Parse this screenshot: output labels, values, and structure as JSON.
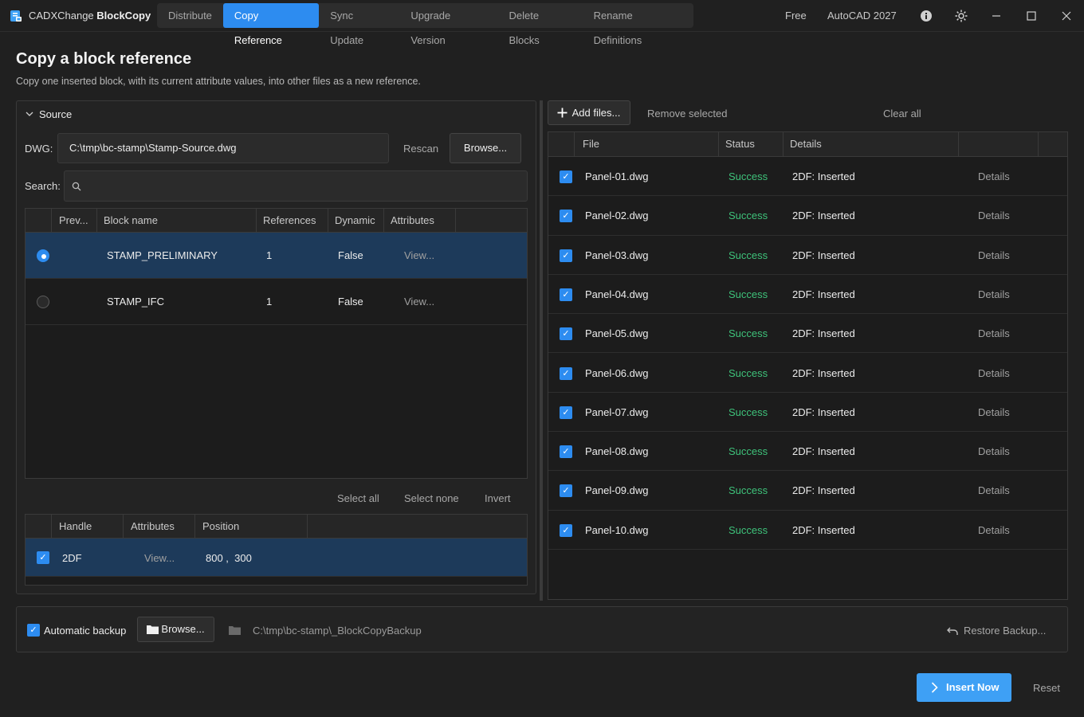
{
  "app": {
    "title_prefix": "CADXChange",
    "title_bold": "BlockCopy",
    "tabs": [
      "Distribute",
      "Copy Reference",
      "Sync Update",
      "Upgrade Version",
      "Delete Blocks",
      "Rename Definitions"
    ],
    "active_tab": "Copy Reference",
    "license": "Free",
    "product": "AutoCAD 2027",
    "accent": "#2d8cf0"
  },
  "page": {
    "title": "Copy a block reference",
    "subtitle": "Copy one inserted block, with its current attribute values, into other files as a new reference."
  },
  "source": {
    "section_label": "Source",
    "dwg_label": "DWG:",
    "dwg_path": "C:\\tmp\\bc-stamp\\Stamp-Source.dwg",
    "rescan": "Rescan",
    "browse": "Browse...",
    "search_label": "Search:",
    "search_value": "",
    "blocks_columns": [
      "Prev...",
      "Block name",
      "References",
      "Dynamic",
      "Attributes"
    ],
    "blocks": [
      {
        "name": "STAMP_PRELIMINARY",
        "references": "1",
        "dynamic": "False",
        "attributes": "View...",
        "selected": true
      },
      {
        "name": "STAMP_IFC",
        "references": "1",
        "dynamic": "False",
        "attributes": "View...",
        "selected": false
      }
    ],
    "select_all": "Select all",
    "select_none": "Select none",
    "invert": "Invert",
    "refs_columns": [
      "Handle",
      "Attributes",
      "Position"
    ],
    "references": [
      {
        "handle": "2DF",
        "attributes": "View...",
        "position": "800 ,  300",
        "checked": true
      }
    ]
  },
  "targets": {
    "add_files": "Add files...",
    "remove_selected": "Remove selected",
    "clear_all": "Clear all",
    "columns": [
      "File",
      "Status",
      "Details"
    ],
    "files": [
      {
        "file": "Panel-01.dwg",
        "status": "Success",
        "details": "2DF: Inserted",
        "action": "Details"
      },
      {
        "file": "Panel-02.dwg",
        "status": "Success",
        "details": "2DF: Inserted",
        "action": "Details"
      },
      {
        "file": "Panel-03.dwg",
        "status": "Success",
        "details": "2DF: Inserted",
        "action": "Details"
      },
      {
        "file": "Panel-04.dwg",
        "status": "Success",
        "details": "2DF: Inserted",
        "action": "Details"
      },
      {
        "file": "Panel-05.dwg",
        "status": "Success",
        "details": "2DF: Inserted",
        "action": "Details"
      },
      {
        "file": "Panel-06.dwg",
        "status": "Success",
        "details": "2DF: Inserted",
        "action": "Details"
      },
      {
        "file": "Panel-07.dwg",
        "status": "Success",
        "details": "2DF: Inserted",
        "action": "Details"
      },
      {
        "file": "Panel-08.dwg",
        "status": "Success",
        "details": "2DF: Inserted",
        "action": "Details"
      },
      {
        "file": "Panel-09.dwg",
        "status": "Success",
        "details": "2DF: Inserted",
        "action": "Details"
      },
      {
        "file": "Panel-10.dwg",
        "status": "Success",
        "details": "2DF: Inserted",
        "action": "Details"
      }
    ]
  },
  "backup": {
    "auto_label": "Automatic backup",
    "auto_checked": true,
    "browse": "Browse...",
    "path": "C:\\tmp\\bc-stamp\\_BlockCopyBackup",
    "restore": "Restore Backup..."
  },
  "footer": {
    "insert_now": "Insert Now",
    "reset": "Reset"
  }
}
